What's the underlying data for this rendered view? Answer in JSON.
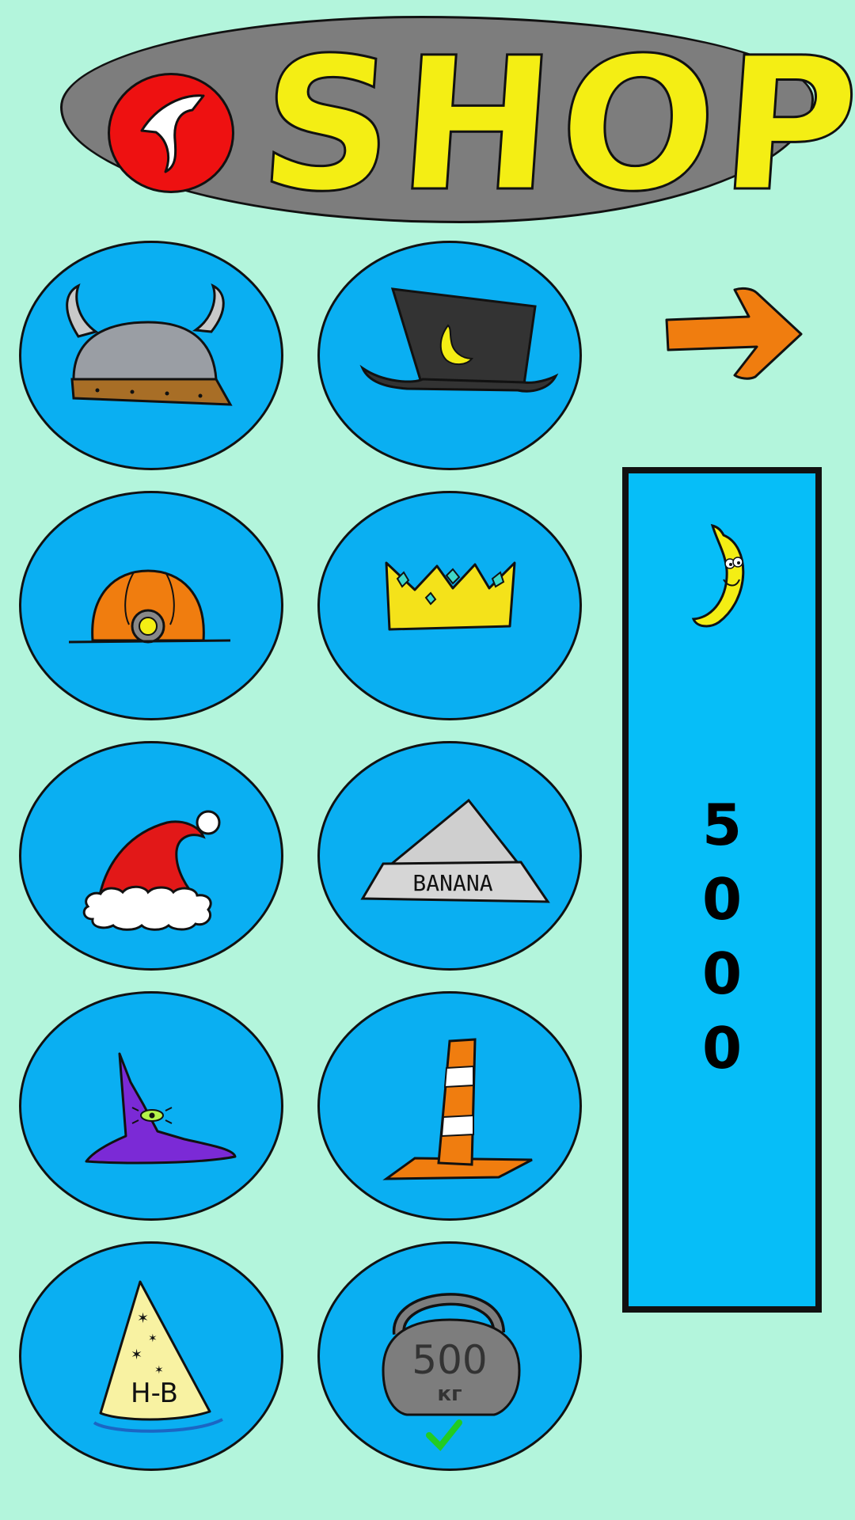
{
  "header": {
    "title": "SHOP"
  },
  "shop_items": [
    {
      "item": "viking-helmet"
    },
    {
      "item": "top-hat-banana"
    },
    {
      "item": "miner-helmet"
    },
    {
      "item": "crown"
    },
    {
      "item": "santa-hat"
    },
    {
      "item": "banana-mountain-hat",
      "label": "BANANA"
    },
    {
      "item": "wizard-hat"
    },
    {
      "item": "traffic-cone"
    },
    {
      "item": "party-hat",
      "label": "H-B"
    },
    {
      "item": "kettlebell",
      "label_top": "500",
      "label_bottom": "кг",
      "equipped": true
    }
  ],
  "balance": {
    "currency_icon": "banana-icon",
    "amount": "5000"
  },
  "colors": {
    "background": "#b3f5dc",
    "header": "#7d7d7d",
    "title": "#f4ee14",
    "back_button": "#ee1111",
    "item_circle": "#0aaff2",
    "balance_panel": "#06bef8",
    "arrow": "#f07d0f",
    "check": "#22cc22"
  }
}
